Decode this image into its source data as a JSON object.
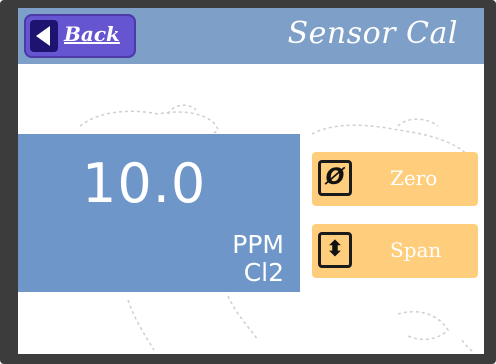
{
  "header": {
    "back_label": "Back",
    "title": "Sensor Cal"
  },
  "reading": {
    "value": "10.0",
    "unit": "PPM",
    "gas": "Cl2"
  },
  "buttons": [
    {
      "label": "Zero",
      "icon": "zero-icon",
      "glyph": "Ø"
    },
    {
      "label": "Span",
      "icon": "up-down-arrow-icon",
      "glyph": "⬍"
    }
  ],
  "colors": {
    "header": "#7e9fc8",
    "back_button": "#6655d1",
    "reading_panel": "#6e96c9",
    "cal_button": "#ffce7d"
  }
}
